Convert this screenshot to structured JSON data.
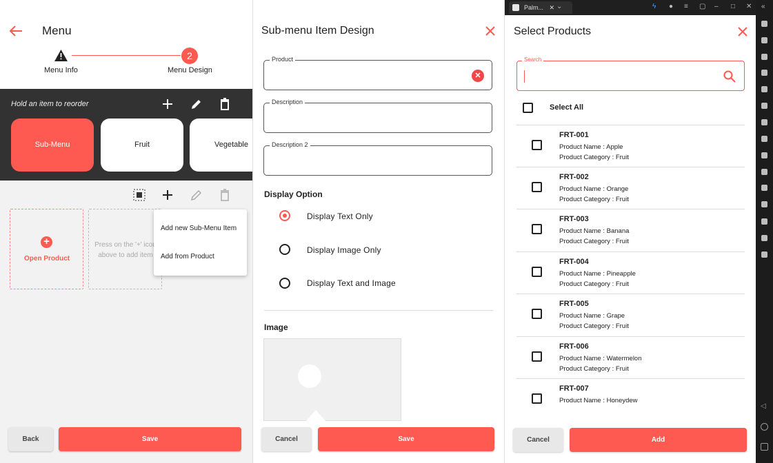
{
  "panel1": {
    "title": "Menu",
    "steps": [
      {
        "label": "Menu Info"
      },
      {
        "label": "Menu Design",
        "number": "2"
      }
    ],
    "hint": "Hold an item to reorder",
    "cards": [
      "Sub-Menu",
      "Fruit",
      "Vegetable"
    ],
    "open_product": "Open Product",
    "press_text": "Press on the '+' icon above to add item",
    "popup": [
      "Add new Sub-Menu Item",
      "Add from Product"
    ],
    "back": "Back",
    "save": "Save"
  },
  "panel2": {
    "title": "Sub-menu Item Design",
    "fields": [
      "Product",
      "Description",
      "Description 2"
    ],
    "display_option": "Display Option",
    "options": [
      "Display Text Only",
      "Display Image Only",
      "Display Text and Image"
    ],
    "selected_option": 0,
    "image_label": "Image",
    "cancel": "Cancel",
    "save": "Save"
  },
  "panel3": {
    "window_tab": "Palm...",
    "title": "Select Products",
    "search_label": "Search",
    "select_all": "Select All",
    "items": [
      {
        "code": "FRT-001",
        "name": "Product Name : Apple",
        "category": "Product Category : Fruit"
      },
      {
        "code": "FRT-002",
        "name": "Product Name : Orange",
        "category": "Product Category : Fruit"
      },
      {
        "code": "FRT-003",
        "name": "Product Name : Banana",
        "category": "Product Category : Fruit"
      },
      {
        "code": "FRT-004",
        "name": "Product Name : Pineapple",
        "category": "Product Category : Fruit"
      },
      {
        "code": "FRT-005",
        "name": "Product Name : Grape",
        "category": "Product Category : Fruit"
      },
      {
        "code": "FRT-006",
        "name": "Product Name : Watermelon",
        "category": "Product Category : Fruit"
      },
      {
        "code": "FRT-007",
        "name": "Product Name : Honeydew",
        "category": ""
      }
    ],
    "cancel": "Cancel",
    "add": "Add"
  },
  "colors": {
    "accent": "#ff5a52",
    "dark": "#323232"
  }
}
